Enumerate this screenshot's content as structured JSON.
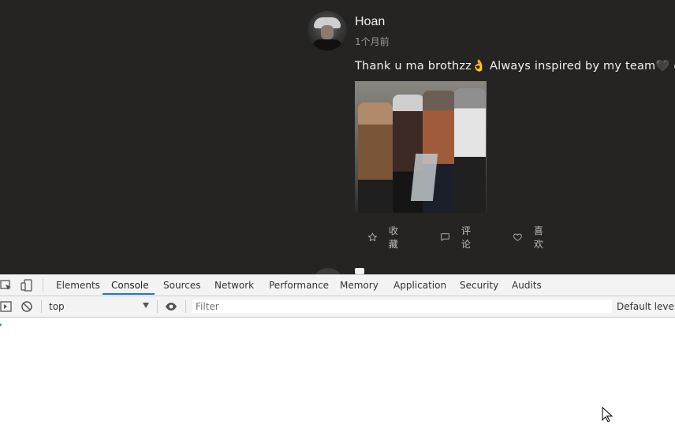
{
  "post": {
    "username": "Hoan",
    "time": "1个月前",
    "text": "Thank u ma brothzz👌 Always inspired by my team🖤 @w",
    "actions": [
      {
        "icon": "star-icon",
        "label": "收藏"
      },
      {
        "icon": "comment-icon",
        "label": "评论"
      },
      {
        "icon": "heart-icon",
        "label": "喜欢"
      }
    ]
  },
  "devtools": {
    "tabs": [
      "Elements",
      "Console",
      "Sources",
      "Network",
      "Performance",
      "Memory",
      "Application",
      "Security",
      "Audits"
    ],
    "active_tab": "Console",
    "context": "top",
    "filter_placeholder": "Filter",
    "levels": "Default levels",
    "accent": "#1a73e8"
  },
  "colors": {
    "page_background": "#252423",
    "devtools_bar": "#f3f3f3"
  }
}
